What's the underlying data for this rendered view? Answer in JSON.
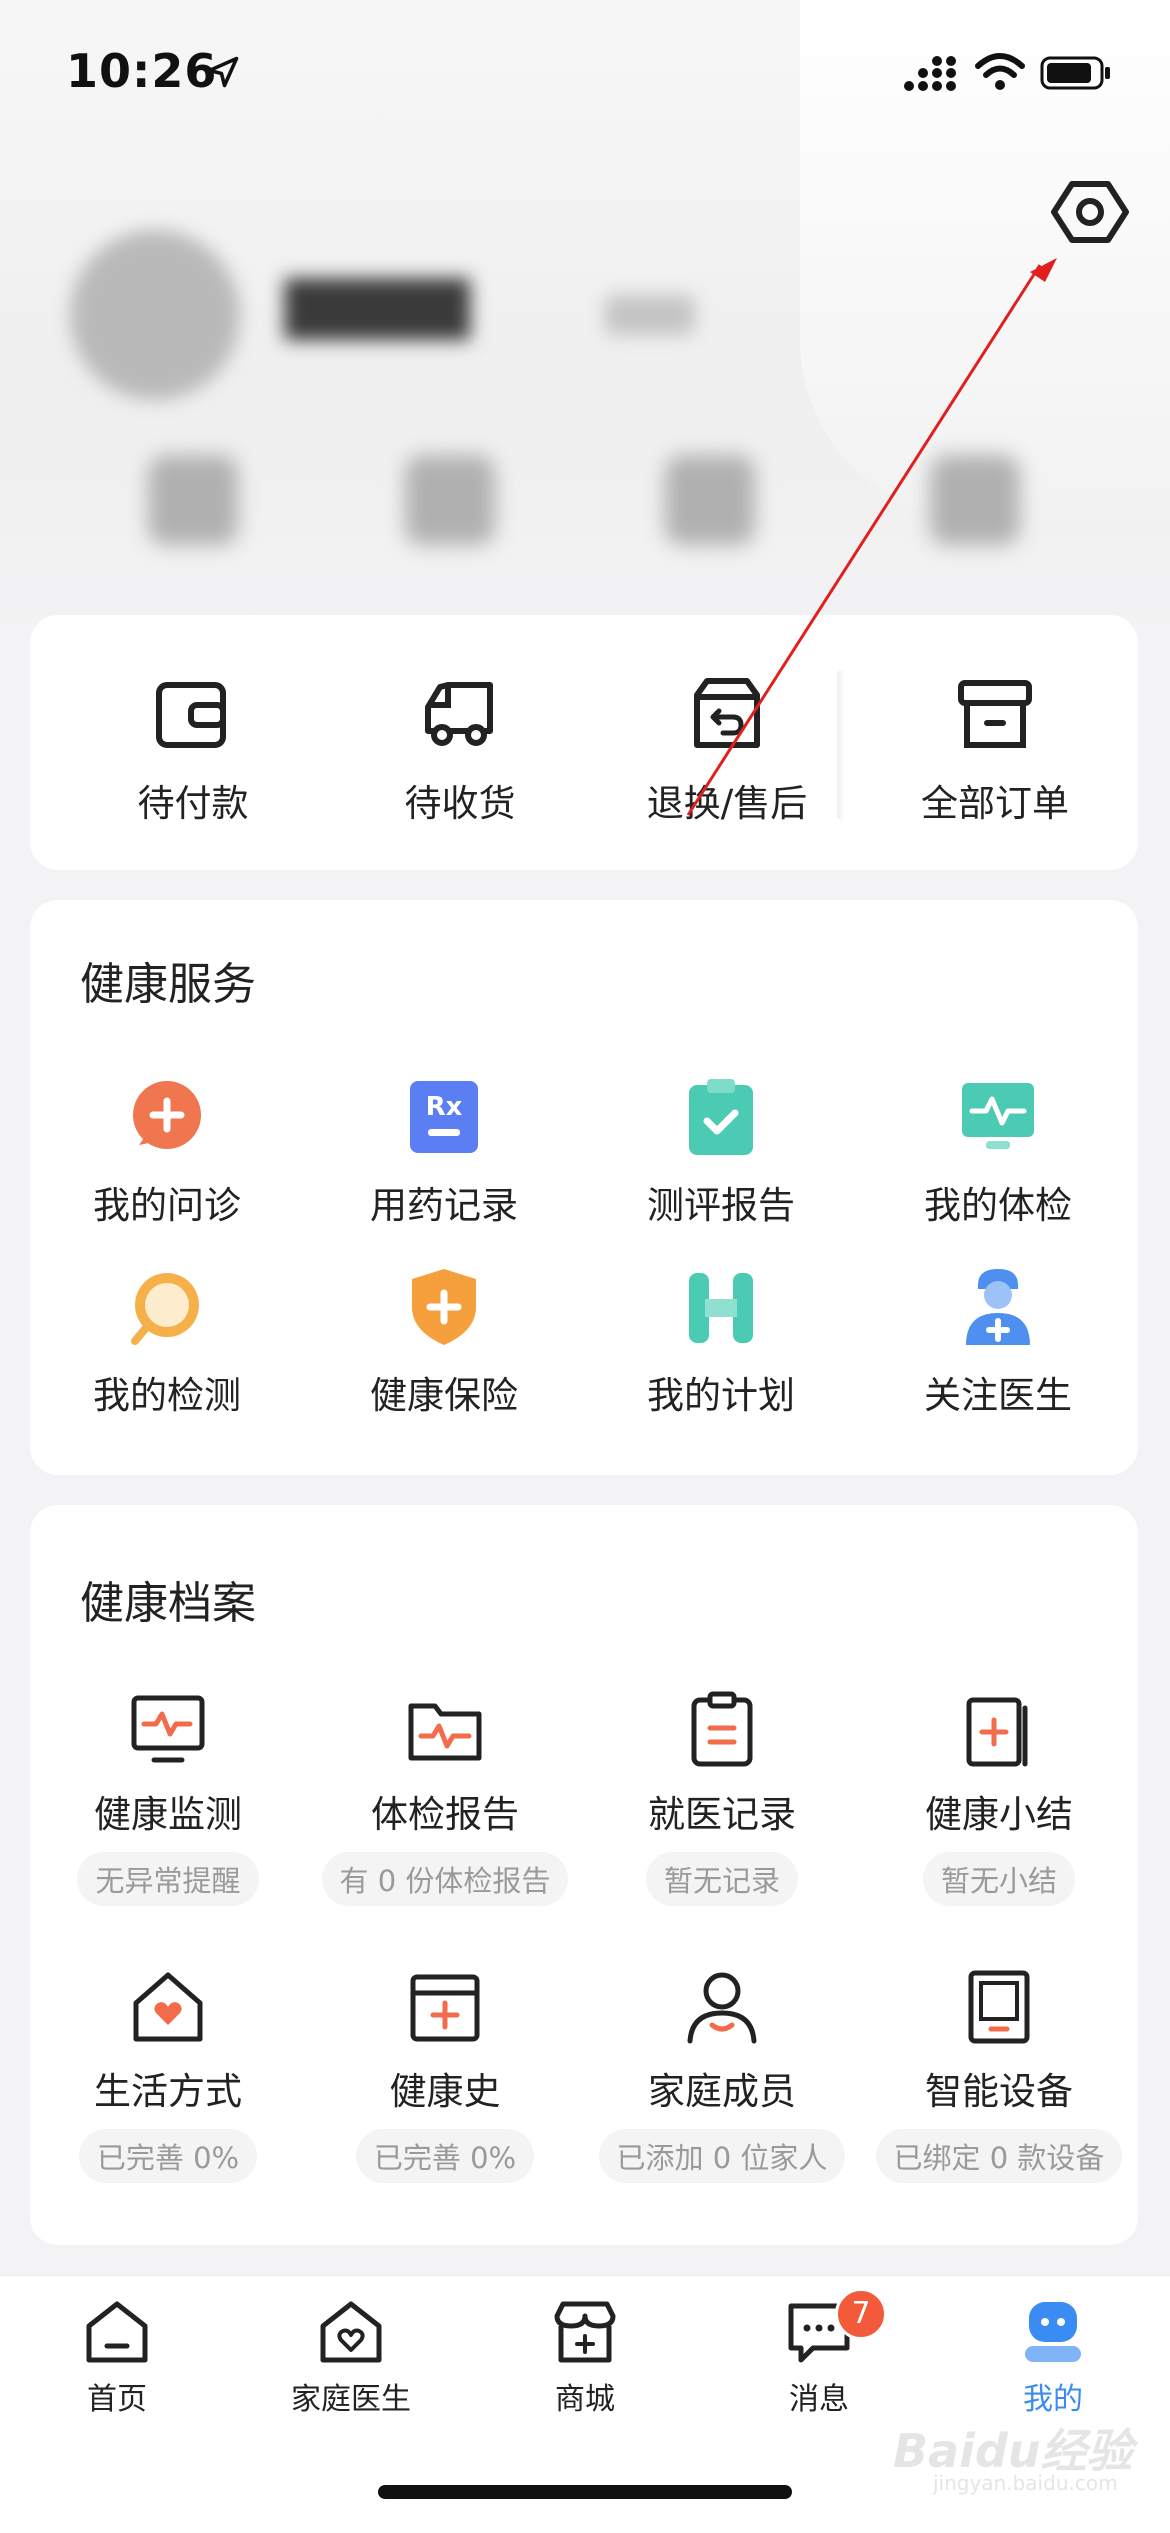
{
  "status_bar": {
    "time": "10:26"
  },
  "orders": [
    {
      "label": "待付款",
      "icon": "wallet-icon"
    },
    {
      "label": "待收货",
      "icon": "delivery-truck-icon"
    },
    {
      "label": "退换/售后",
      "icon": "return-box-icon"
    },
    {
      "label": "全部订单",
      "icon": "archive-box-icon"
    }
  ],
  "health_services": {
    "title": "健康服务",
    "items": [
      {
        "label": "我的问诊",
        "icon": "consultation-icon",
        "color": "#f0764f"
      },
      {
        "label": "用药记录",
        "icon": "rx-icon",
        "color": "#5b7ff2"
      },
      {
        "label": "测评报告",
        "icon": "clipboard-check-icon",
        "color": "#4ccbb4"
      },
      {
        "label": "我的体检",
        "icon": "monitor-pulse-icon",
        "color": "#4ccbb4"
      },
      {
        "label": "我的检测",
        "icon": "magnifier-icon",
        "color": "#f5b04a"
      },
      {
        "label": "健康保险",
        "icon": "shield-plus-icon",
        "color": "#f5a03c"
      },
      {
        "label": "我的计划",
        "icon": "plan-h-icon",
        "color": "#4ccbb4"
      },
      {
        "label": "关注医生",
        "icon": "doctor-icon",
        "color": "#4f8ff0"
      }
    ]
  },
  "health_records": {
    "title": "健康档案",
    "items": [
      {
        "label": "健康监测",
        "sub": "无异常提醒",
        "icon": "monitor-icon"
      },
      {
        "label": "体检报告",
        "sub": "有 0 份体检报告",
        "icon": "folder-pulse-icon"
      },
      {
        "label": "就医记录",
        "sub": "暂无记录",
        "icon": "clipboard-icon"
      },
      {
        "label": "健康小结",
        "sub": "暂无小结",
        "icon": "document-plus-icon"
      },
      {
        "label": "生活方式",
        "sub": "已完善 0%",
        "icon": "house-heart-icon"
      },
      {
        "label": "健康史",
        "sub": "已完善 0%",
        "icon": "calendar-plus-icon"
      },
      {
        "label": "家庭成员",
        "sub": "已添加 0 位家人",
        "icon": "person-icon"
      },
      {
        "label": "智能设备",
        "sub": "已绑定 0 款设备",
        "icon": "device-icon"
      }
    ]
  },
  "tabs": [
    {
      "label": "首页",
      "icon": "home-icon",
      "active": false
    },
    {
      "label": "家庭医生",
      "icon": "home-heart-icon",
      "active": false
    },
    {
      "label": "商城",
      "icon": "shop-icon",
      "active": false
    },
    {
      "label": "消息",
      "icon": "message-icon",
      "active": false,
      "badge": "7"
    },
    {
      "label": "我的",
      "icon": "profile-robot-icon",
      "active": true
    }
  ],
  "colors": {
    "accent": "#3b8cf2",
    "badge": "#f25a3a",
    "icon_orange": "#f26b4b",
    "annotation": "#e02020"
  },
  "watermark": {
    "text": "Baidu经验",
    "sub": "jingyan.baidu.com"
  }
}
